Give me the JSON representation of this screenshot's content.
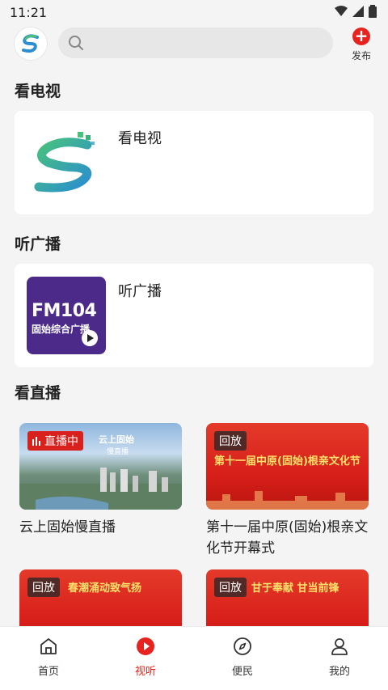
{
  "status": {
    "time": "11:21"
  },
  "header": {
    "search_placeholder": "",
    "publish_label": "发布"
  },
  "sections": {
    "tv": {
      "title": "看电视",
      "card_label": "看电视"
    },
    "radio": {
      "title": "听广播",
      "card_label": "听广播",
      "thumb_main": "FM104",
      "thumb_sub": "固始综合广播"
    },
    "live": {
      "title": "看直播",
      "items": [
        {
          "badge": "直播中",
          "thumb_text": "云上固始",
          "thumb_subtext": "慢直播",
          "caption": "云上固始慢直播"
        },
        {
          "badge": "回放",
          "thumb_text": "第十一届中原(固始)根亲文化节",
          "caption": "第十一届中原(固始)根亲文化节开幕式"
        },
        {
          "badge": "回放",
          "thumb_text": "春潮涌动致气扬",
          "caption": ""
        },
        {
          "badge": "回放",
          "thumb_text": "甘于奉献 甘当前锋",
          "caption": ""
        }
      ]
    }
  },
  "tabbar": {
    "items": [
      {
        "label": "首页",
        "icon": "home-icon"
      },
      {
        "label": "视听",
        "icon": "play-icon",
        "active": true
      },
      {
        "label": "便民",
        "icon": "compass-icon"
      },
      {
        "label": "我的",
        "icon": "user-icon"
      }
    ]
  },
  "colors": {
    "accent": "#e8231f",
    "background": "#f4f4f4",
    "card": "#ffffff"
  }
}
